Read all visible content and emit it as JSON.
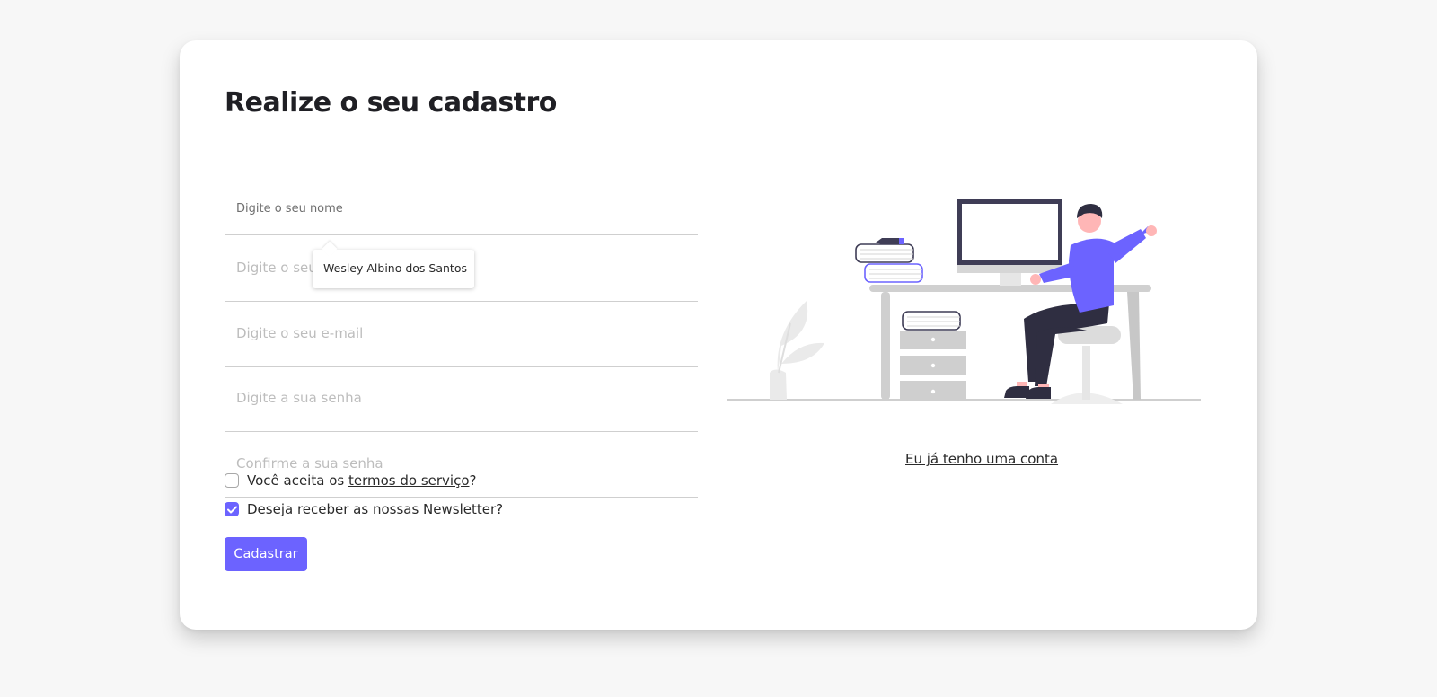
{
  "page": {
    "title": "Realize o seu cadastro"
  },
  "form": {
    "name_placeholder": "Digite o seu nome",
    "nickname_placeholder": "Digite o seu",
    "email_placeholder": "Digite o seu e-mail",
    "password_placeholder": "Digite a sua senha",
    "confirm_placeholder": "Confirme a sua senha",
    "autocomplete_suggestion": "Wesley Albino dos Santos",
    "terms_prefix": "Você aceita os ",
    "terms_link": "termos do serviço",
    "terms_suffix": "?",
    "terms_checked": false,
    "newsletter_label": "Deseja receber as nossas Newsletter?",
    "newsletter_checked": true,
    "submit_label": "Cadastrar"
  },
  "side": {
    "login_link": "Eu já tenho uma conta",
    "illustration": "person-at-desk-illustration"
  },
  "colors": {
    "accent": "#6c63ff",
    "background": "#f7f7f7",
    "card": "#ffffff",
    "text": "#1f1f24"
  }
}
